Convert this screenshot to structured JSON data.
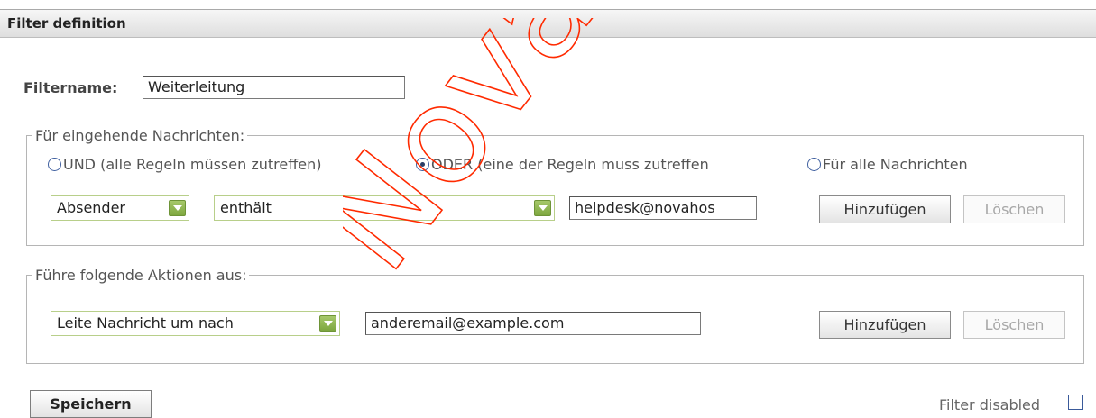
{
  "header": {
    "title": "Filter definition"
  },
  "filtername": {
    "label": "Filtername:",
    "value": "Weiterleitung"
  },
  "incoming": {
    "legend": "Für eingehende Nachrichten:",
    "radios": [
      {
        "label": "UND (alle Regeln müssen zutreffen)",
        "checked": false
      },
      {
        "label": "ODER (eine der Regeln muss zutreffen",
        "checked": true
      },
      {
        "label": "Für alle Nachrichten",
        "checked": false
      }
    ],
    "field_select": "Absender",
    "operator_select": "enthält",
    "value": "helpdesk@novahos",
    "add_label": "Hinzufügen",
    "delete_label": "Löschen"
  },
  "actions": {
    "legend": "Führe folgende Aktionen aus:",
    "action_select": "Leite Nachricht um nach",
    "value": "anderemail@example.com",
    "add_label": "Hinzufügen",
    "delete_label": "Löschen"
  },
  "footer": {
    "save_label": "Speichern",
    "disabled_label": "Filter disabled",
    "disabled_checked": false
  },
  "watermark": {
    "text": "Nova Ho",
    "color": "#ff2a00"
  },
  "colors": {
    "accent": "#8ab04f",
    "radio": "#4060a0"
  }
}
